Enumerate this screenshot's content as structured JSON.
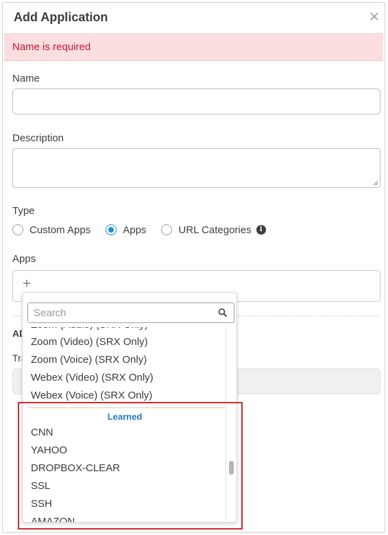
{
  "dialog": {
    "title": "Add Application",
    "close_icon": "close-icon",
    "error": "Name is required"
  },
  "form": {
    "name_label": "Name",
    "name_value": "",
    "description_label": "Description",
    "description_value": "",
    "type_label": "Type",
    "type_options": [
      "Custom Apps",
      "Apps",
      "URL Categories"
    ],
    "type_selected": "Apps",
    "apps_label": "Apps",
    "add_icon": "plus-icon",
    "behind_section_label": "AD",
    "behind_field_label": "Tra"
  },
  "dropdown": {
    "search_placeholder": "Search",
    "search_icon": "search-icon",
    "options_top": [
      "Zoom (Video) (SRX Only)",
      "Zoom (Voice) (SRX Only)",
      "Webex (Video) (SRX Only)",
      "Webex (Voice) (SRX Only)"
    ],
    "group_label": "Learned",
    "options_learned": [
      "CNN",
      "YAHOO",
      "DROPBOX-CLEAR",
      "SSL",
      "SSH",
      "AMAZON"
    ]
  },
  "colors": {
    "error_text": "#c2142f",
    "error_bg": "#fbdfe0",
    "accent": "#1a90e0",
    "group_label": "#1f7ac2",
    "highlight": "#d9262d"
  }
}
